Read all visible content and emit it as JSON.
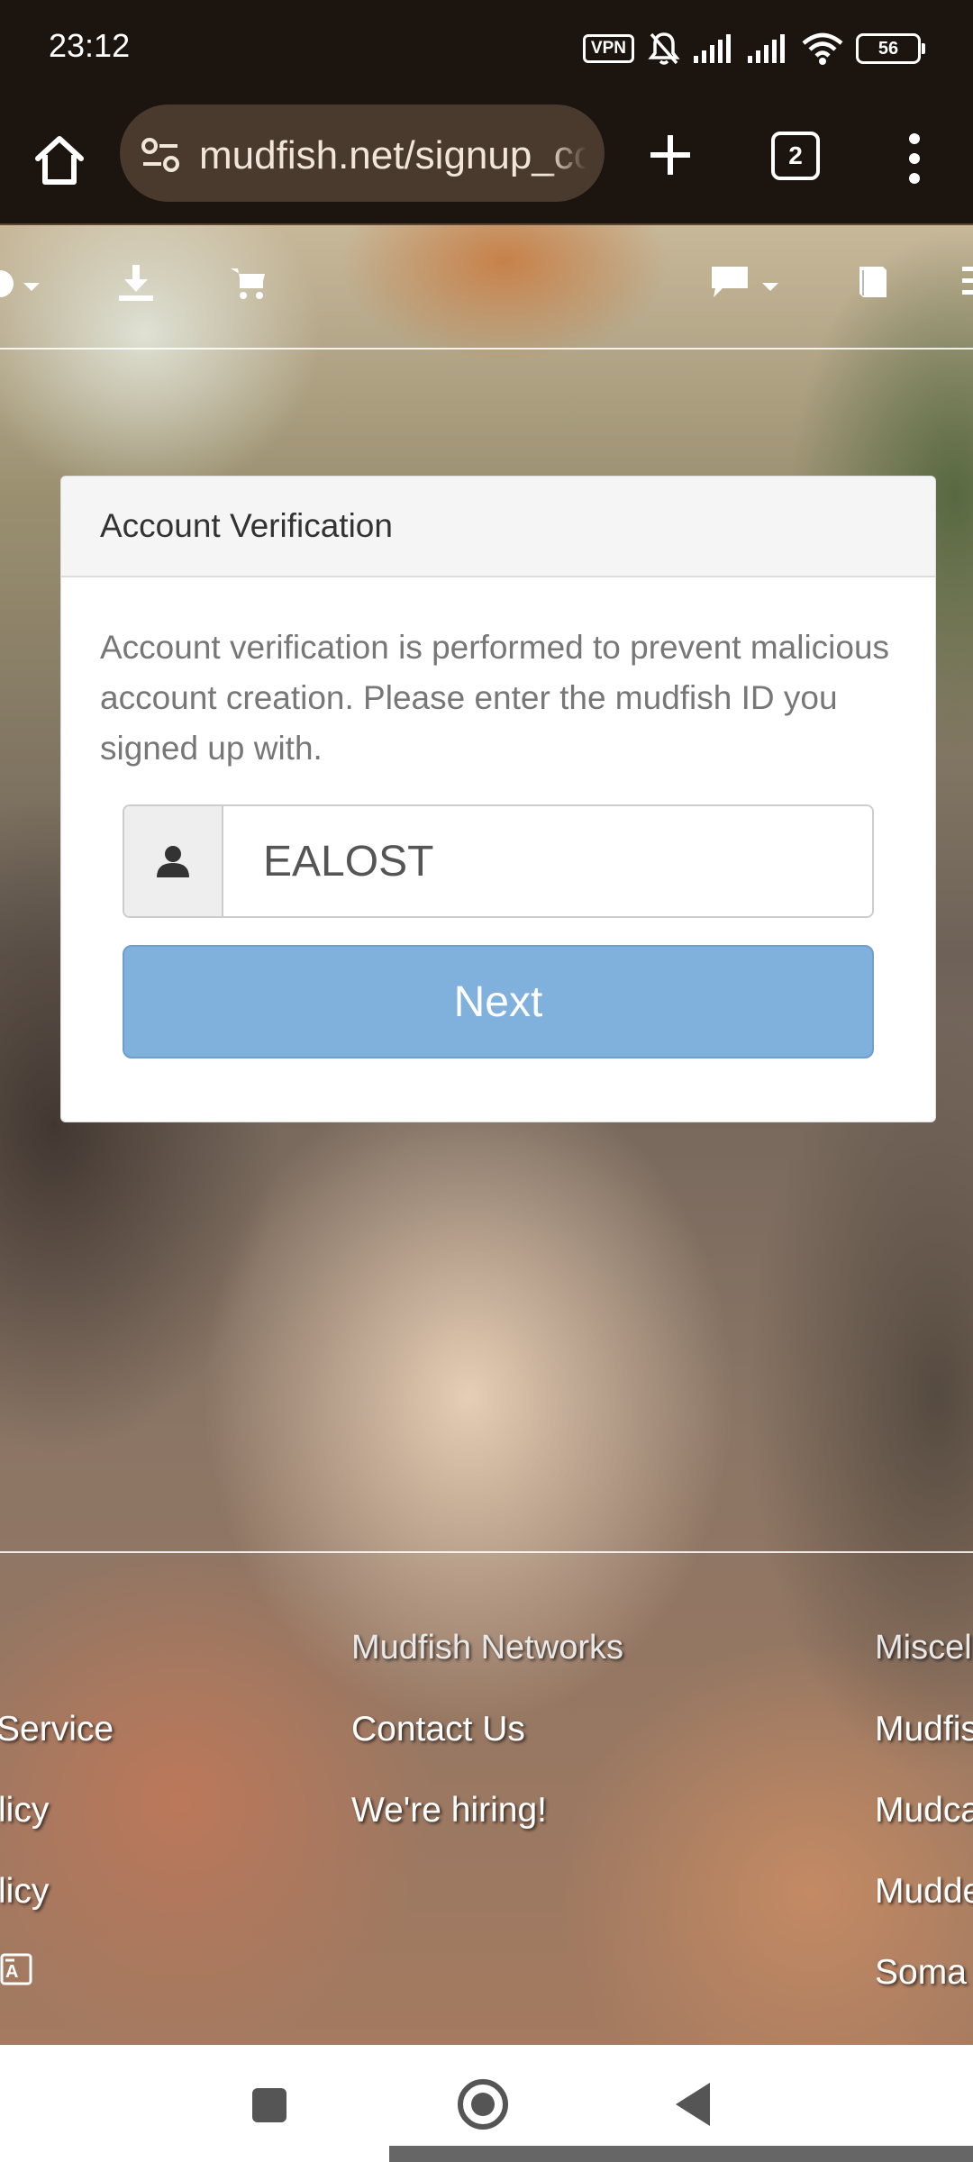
{
  "status_bar": {
    "time": "23:12",
    "vpn": "VPN",
    "battery": "56"
  },
  "browser": {
    "url": "mudfish.net/signup_confirm",
    "tab_count": "2"
  },
  "card": {
    "title": "Account Verification",
    "description": "Account verification is performed to prevent malicious account creation. Please enter the mudfish ID you signed up with.",
    "id_value": "EALOST",
    "next_label": "Next"
  },
  "footer": {
    "col1": [
      "Service",
      "licy",
      "licy"
    ],
    "col2_heading": "Mudfish Networks",
    "col2": [
      "Contact Us",
      "We're hiring!"
    ],
    "col3_heading": "Miscel",
    "col3": [
      "Mudfis",
      "Mudca",
      "Mudde",
      "Soma"
    ]
  },
  "colors": {
    "next_button": "#80b1dd",
    "browser_chrome": "#1b140f"
  }
}
